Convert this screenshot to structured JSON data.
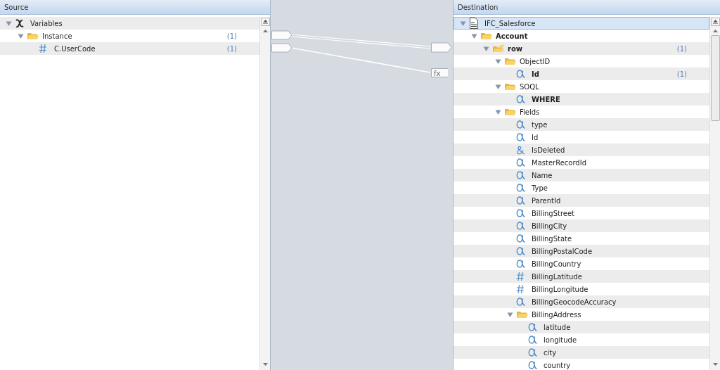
{
  "source": {
    "title": "Source",
    "tree": [
      {
        "label": "Variables",
        "kind": "variables",
        "expanded": true,
        "selected": false,
        "required": false,
        "children": [
          {
            "label": "Instance",
            "kind": "folder",
            "expanded": true,
            "selected": false,
            "required": false,
            "count": "(1)",
            "children": [
              {
                "label": "C.UserCode",
                "kind": "number",
                "selected": false,
                "required": false,
                "count": "(1)"
              }
            ]
          }
        ]
      }
    ]
  },
  "connectors": [
    {
      "kind": "direct"
    },
    {
      "kind": "function",
      "label": "fx"
    }
  ],
  "destination": {
    "title": "Destination",
    "tree": [
      {
        "label": "IFC_Salesforce",
        "kind": "xsd",
        "expanded": true,
        "selected": true,
        "required": false,
        "children": [
          {
            "label": "Account",
            "kind": "folder",
            "expanded": true,
            "selected": false,
            "required": true,
            "children": [
              {
                "label": "row",
                "kind": "folder-open",
                "expanded": true,
                "selected": false,
                "required": true,
                "count": "(1)",
                "children": [
                  {
                    "label": "ObjectID",
                    "kind": "folder",
                    "expanded": true,
                    "selected": false,
                    "required": false,
                    "children": [
                      {
                        "label": "Id",
                        "kind": "text",
                        "selected": false,
                        "required": true,
                        "count": "(1)"
                      }
                    ]
                  },
                  {
                    "label": "SOQL",
                    "kind": "folder",
                    "expanded": true,
                    "selected": false,
                    "required": false,
                    "children": [
                      {
                        "label": "WHERE",
                        "kind": "text",
                        "selected": false,
                        "required": true
                      }
                    ]
                  },
                  {
                    "label": "Fields",
                    "kind": "folder",
                    "expanded": true,
                    "selected": false,
                    "required": false,
                    "children": [
                      {
                        "label": "type",
                        "kind": "text",
                        "selected": false,
                        "required": false
                      },
                      {
                        "label": "Id",
                        "kind": "text",
                        "selected": false,
                        "required": false
                      },
                      {
                        "label": "IsDeleted",
                        "kind": "boolean",
                        "selected": false,
                        "required": false
                      },
                      {
                        "label": "MasterRecordId",
                        "kind": "text",
                        "selected": false,
                        "required": false
                      },
                      {
                        "label": "Name",
                        "kind": "text",
                        "selected": false,
                        "required": false
                      },
                      {
                        "label": "Type",
                        "kind": "text",
                        "selected": false,
                        "required": false
                      },
                      {
                        "label": "ParentId",
                        "kind": "text",
                        "selected": false,
                        "required": false
                      },
                      {
                        "label": "BillingStreet",
                        "kind": "text",
                        "selected": false,
                        "required": false
                      },
                      {
                        "label": "BillingCity",
                        "kind": "text",
                        "selected": false,
                        "required": false
                      },
                      {
                        "label": "BillingState",
                        "kind": "text",
                        "selected": false,
                        "required": false
                      },
                      {
                        "label": "BillingPostalCode",
                        "kind": "text",
                        "selected": false,
                        "required": false
                      },
                      {
                        "label": "BillingCountry",
                        "kind": "text",
                        "selected": false,
                        "required": false
                      },
                      {
                        "label": "BillingLatitude",
                        "kind": "number",
                        "selected": false,
                        "required": false
                      },
                      {
                        "label": "BillingLongitude",
                        "kind": "number",
                        "selected": false,
                        "required": false
                      },
                      {
                        "label": "BillingGeocodeAccuracy",
                        "kind": "text",
                        "selected": false,
                        "required": false
                      },
                      {
                        "label": "BillingAddress",
                        "kind": "folder",
                        "expanded": true,
                        "selected": false,
                        "required": false,
                        "children": [
                          {
                            "label": "latitude",
                            "kind": "text",
                            "selected": false,
                            "required": false
                          },
                          {
                            "label": "longitude",
                            "kind": "text",
                            "selected": false,
                            "required": false
                          },
                          {
                            "label": "city",
                            "kind": "text",
                            "selected": false,
                            "required": false
                          },
                          {
                            "label": "country",
                            "kind": "text",
                            "selected": false,
                            "required": false
                          }
                        ]
                      }
                    ]
                  }
                ]
              }
            ]
          }
        ]
      }
    ]
  }
}
